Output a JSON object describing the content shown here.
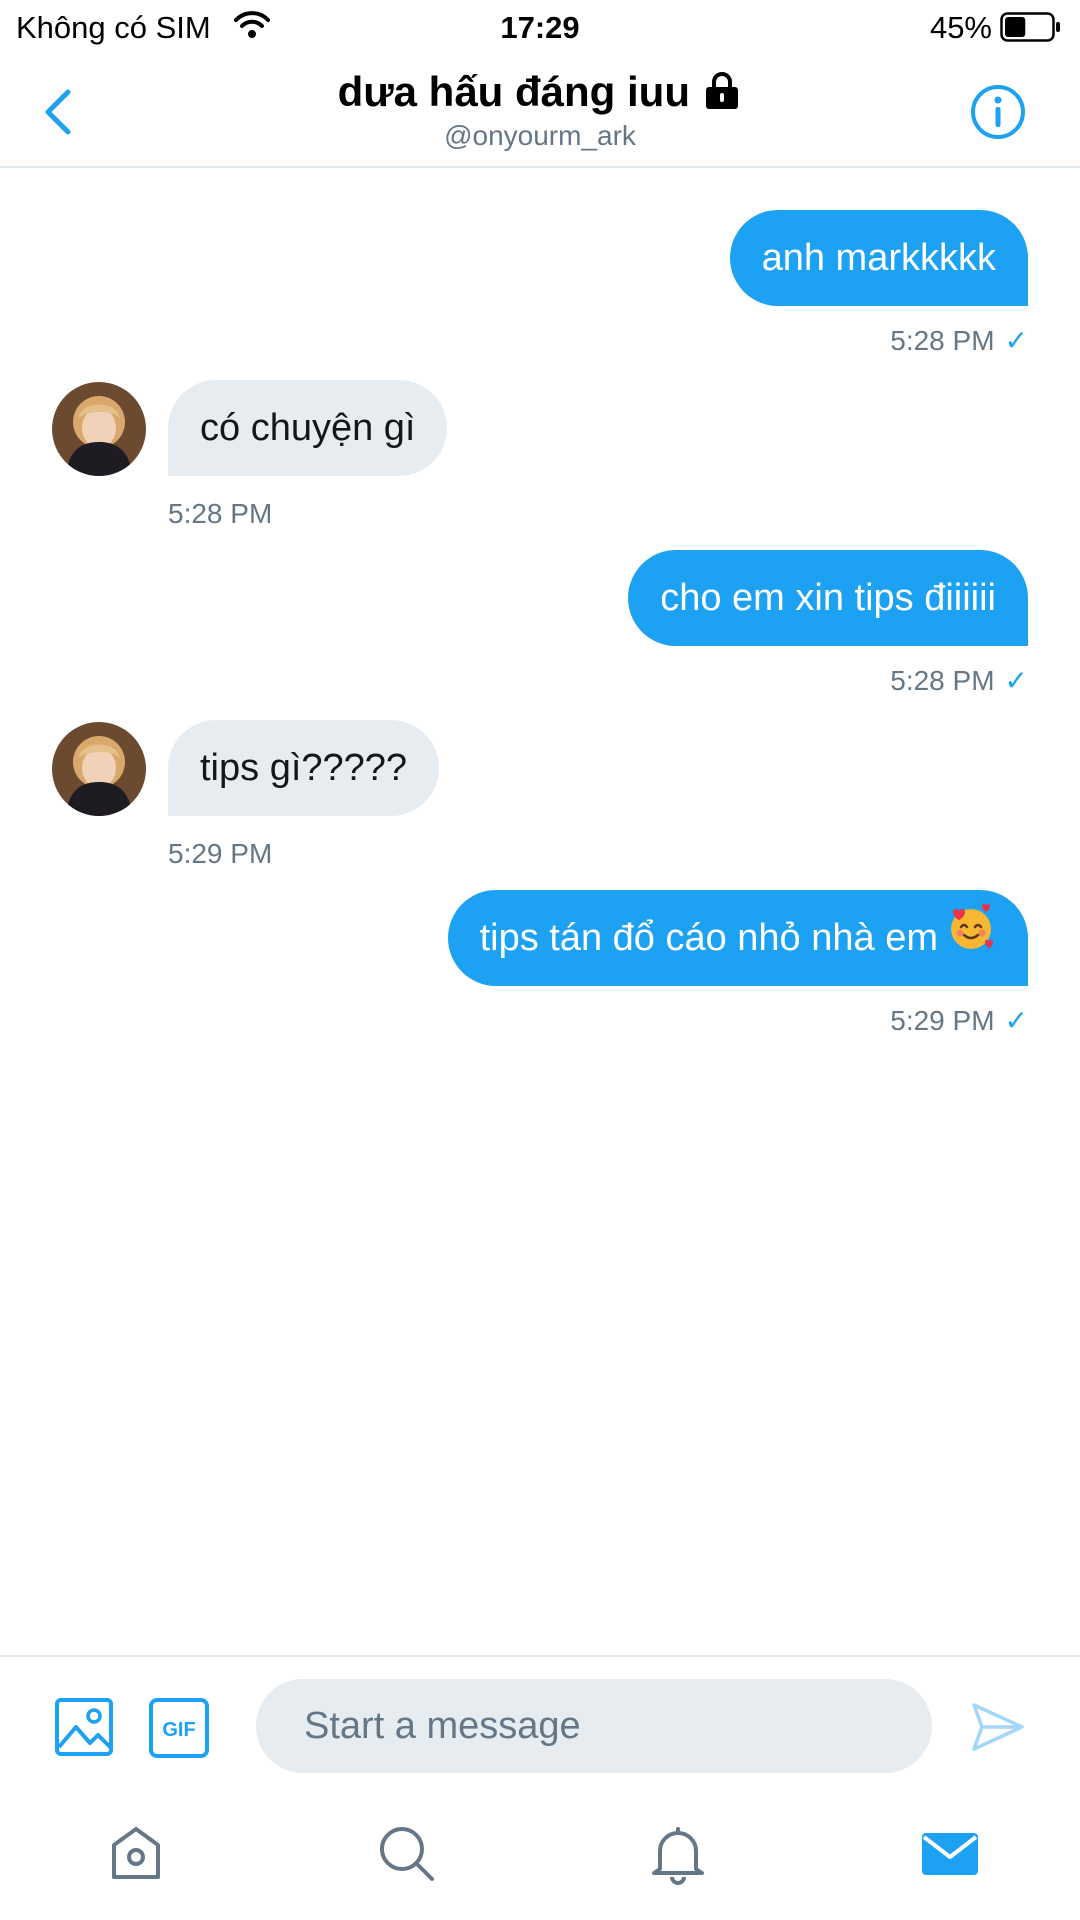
{
  "status_bar": {
    "carrier": "Không có SIM",
    "time": "17:29",
    "battery_percent": "45%",
    "battery_level": 0.45
  },
  "header": {
    "title": "dưa hấu đáng iuu",
    "handle": "@onyourm_ark",
    "icons": [
      "back-arrow-icon",
      "lock-icon",
      "info-icon"
    ]
  },
  "messages": [
    {
      "direction": "outgoing",
      "text": "anh markkkkk",
      "time": "5:28 PM",
      "status": "✓"
    },
    {
      "direction": "incoming",
      "text": "có chuyện gì",
      "time": "5:28 PM"
    },
    {
      "direction": "outgoing",
      "text": "cho em xin tips điiiiii",
      "time": "5:28 PM",
      "status": "✓"
    },
    {
      "direction": "incoming",
      "text": "tips gì?????",
      "time": "5:29 PM"
    },
    {
      "direction": "outgoing",
      "text": "tips tán đổ cáo nhỏ nhà em",
      "emoji": "smiling-face-with-hearts",
      "time": "5:29 PM",
      "status": "✓"
    }
  ],
  "composer": {
    "placeholder": "Start a message",
    "value": "",
    "gif_label": "GIF",
    "icons": [
      "image-icon",
      "gif-icon",
      "send-icon"
    ]
  },
  "tab_bar": {
    "icons": [
      "home-icon",
      "search-icon",
      "notifications-icon",
      "messages-icon"
    ],
    "active": "messages-icon"
  },
  "colors": {
    "accent": "#1da1f2",
    "incoming_bubble": "#e6ecf0",
    "secondary_text": "#657786",
    "divider": "#e1e8ed",
    "send_disabled": "#a3d6f7"
  }
}
